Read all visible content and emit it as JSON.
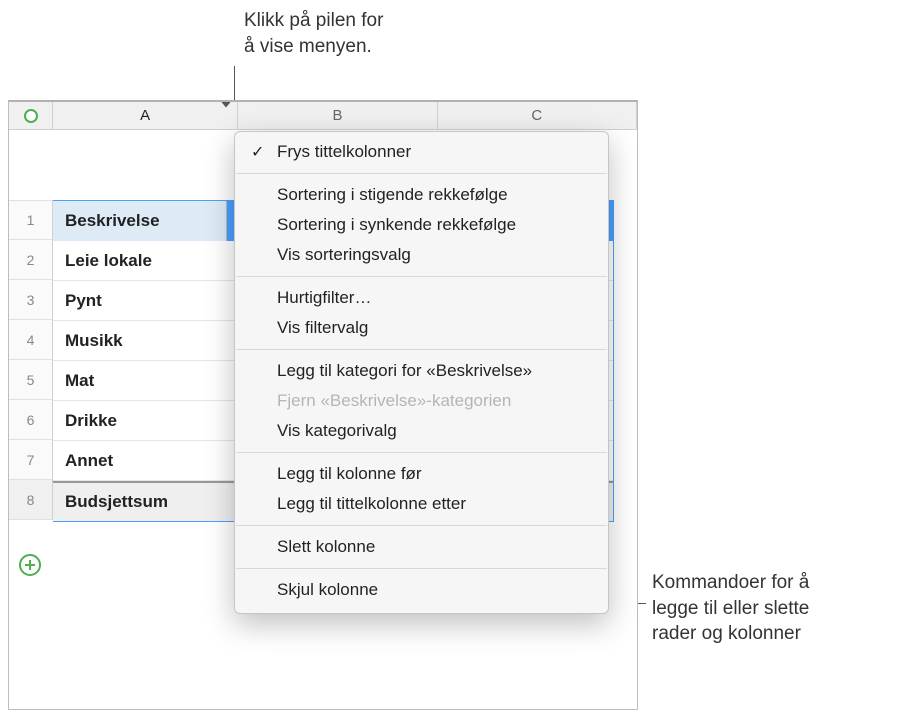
{
  "callouts": {
    "top": "Klikk på pilen for\nå vise menyen.",
    "right": "Kommandoer for å\nlegge til eller slette\nrader og kolonner"
  },
  "columns": {
    "a": "A",
    "b": "B",
    "c": "C"
  },
  "row_numbers": [
    "1",
    "2",
    "3",
    "4",
    "5",
    "6",
    "7",
    "8"
  ],
  "rows": {
    "header": "Beskrivelse",
    "data": [
      "Leie lokale",
      "Pynt",
      "Musikk",
      "Mat",
      "Drikke",
      "Annet"
    ],
    "footer": "Budsjettsum"
  },
  "menu": {
    "groups": [
      [
        {
          "label": "Frys tittelkolonner",
          "checked": true
        }
      ],
      [
        {
          "label": "Sortering i stigende rekkefølge"
        },
        {
          "label": "Sortering i synkende rekkefølge"
        },
        {
          "label": "Vis sorteringsvalg"
        }
      ],
      [
        {
          "label": "Hurtigfilter…"
        },
        {
          "label": "Vis filtervalg"
        }
      ],
      [
        {
          "label": "Legg til kategori for «Beskrivelse»"
        },
        {
          "label": "Fjern «Beskrivelse»-kategorien",
          "disabled": true
        },
        {
          "label": "Vis kategorivalg"
        }
      ],
      [
        {
          "label": "Legg til kolonne før"
        },
        {
          "label": "Legg til tittelkolonne etter"
        }
      ],
      [
        {
          "label": "Slett kolonne"
        }
      ],
      [
        {
          "label": "Skjul kolonne"
        }
      ]
    ]
  }
}
